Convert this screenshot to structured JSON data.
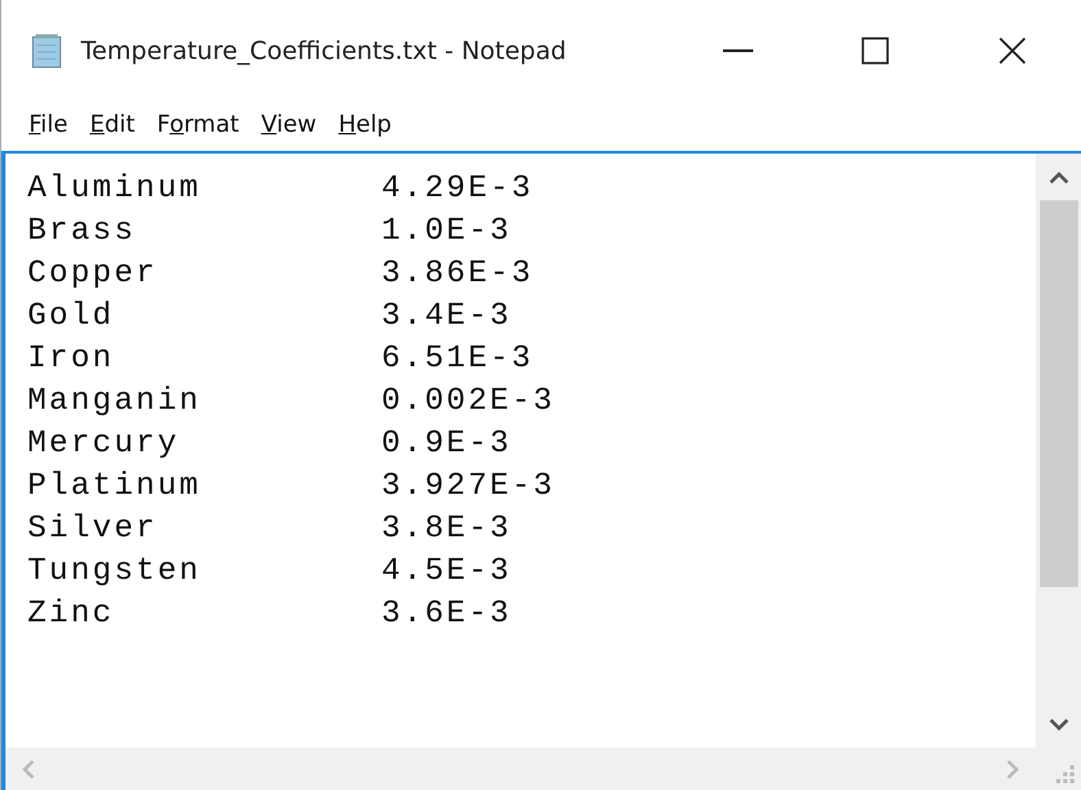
{
  "window": {
    "title": "Temperature_Coefficients.txt - Notepad"
  },
  "menu": [
    {
      "parts": [
        {
          "text": "F",
          "underlined": true
        },
        {
          "text": "ile",
          "underlined": false
        }
      ]
    },
    {
      "parts": [
        {
          "text": "E",
          "underlined": true
        },
        {
          "text": "dit",
          "underlined": false
        }
      ]
    },
    {
      "parts": [
        {
          "text": "F",
          "underlined": false
        },
        {
          "text": "o",
          "underlined": true
        },
        {
          "text": "rmat",
          "underlined": false
        }
      ]
    },
    {
      "parts": [
        {
          "text": "V",
          "underlined": true
        },
        {
          "text": "iew",
          "underlined": false
        }
      ]
    },
    {
      "parts": [
        {
          "text": "H",
          "underlined": true
        },
        {
          "text": "elp",
          "underlined": false
        }
      ]
    }
  ],
  "lines": [
    {
      "name": "Aluminum",
      "value": "4.29E-3"
    },
    {
      "name": "Brass",
      "value": "1.0E-3"
    },
    {
      "name": "Copper",
      "value": "3.86E-3"
    },
    {
      "name": "Gold",
      "value": "3.4E-3"
    },
    {
      "name": "Iron",
      "value": "6.51E-3"
    },
    {
      "name": "Manganin",
      "value": "0.002E-3"
    },
    {
      "name": "Mercury",
      "value": "0.9E-3"
    },
    {
      "name": "Platinum",
      "value": "3.927E-3"
    },
    {
      "name": "Silver",
      "value": "3.8E-3"
    },
    {
      "name": "Tungsten",
      "value": "4.5E-3"
    },
    {
      "name": "Zinc",
      "value": "3.6E-3"
    }
  ]
}
